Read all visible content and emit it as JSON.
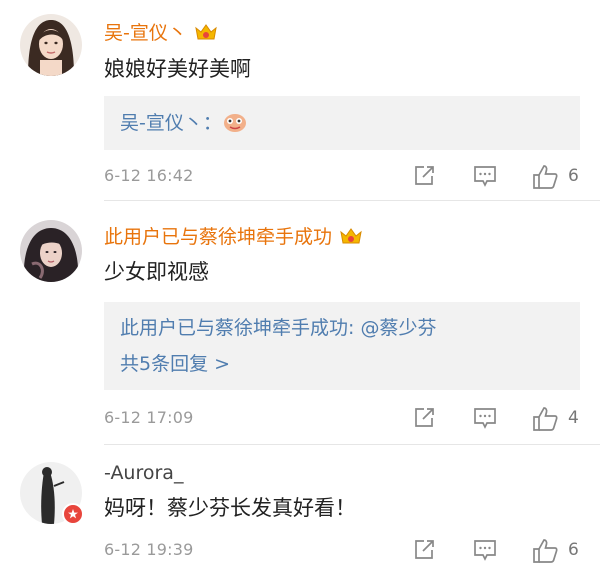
{
  "comments": [
    {
      "username": "吴-宣仪丶",
      "text": "娘娘好美好美啊",
      "quote_lines": [
        "吴-宣仪丶："
      ],
      "timestamp": "6-12 16:42",
      "likes": "6"
    },
    {
      "username": "此用户已与蔡徐坤牵手成功",
      "text": "少女即视感",
      "quote_lines": [
        "此用户已与蔡徐坤牵手成功: @蔡少芬",
        "共5条回复 >"
      ],
      "timestamp": "6-12 17:09",
      "likes": "4"
    },
    {
      "username": "-Aurora_",
      "text": "妈呀！蔡少芬长发真好看！",
      "timestamp": "6-12 19:39",
      "likes": "6"
    }
  ],
  "colors": {
    "username_vip": "#e8740c",
    "link_blue": "#507daf",
    "quote_bg": "#f2f2f2",
    "timestamp": "#9a9a9a"
  },
  "icons": [
    "crown-icon",
    "share-icon",
    "comment-icon",
    "like-icon",
    "verified-badge-icon"
  ]
}
